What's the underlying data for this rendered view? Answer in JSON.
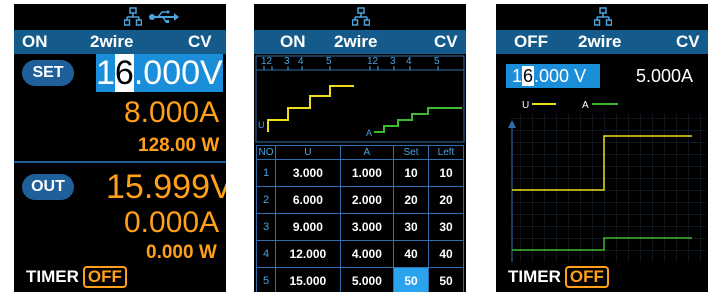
{
  "screen1": {
    "status": {
      "mode": "ON",
      "wire": "2wire",
      "cv": "CV"
    },
    "set": {
      "label": "SET",
      "volt_digit_cursor": "6",
      "volt_prefix": "1",
      "volt_rest": ".000V",
      "current": "8.000A",
      "power": "128.00 W"
    },
    "out": {
      "label": "OUT",
      "voltage": "15.999V",
      "current": "0.000A",
      "power": "0.000 W"
    },
    "timer": {
      "label": "TIMER",
      "state": "OFF"
    }
  },
  "screen2": {
    "status": {
      "mode": "ON",
      "wire": "2wire",
      "cv": "CV"
    },
    "ruler_left": [
      "12",
      "3",
      "4",
      "5"
    ],
    "ruler_right": [
      "12",
      "3",
      "4",
      "5"
    ],
    "graph_v_label": "U",
    "graph_a_label": "A",
    "table": {
      "headers": [
        "NO",
        "U",
        "A",
        "Set",
        "Left"
      ],
      "rows": [
        [
          "1",
          "3.000",
          "1.000",
          "10",
          "10"
        ],
        [
          "2",
          "6.000",
          "2.000",
          "20",
          "20"
        ],
        [
          "3",
          "9.000",
          "3.000",
          "30",
          "30"
        ],
        [
          "4",
          "12.000",
          "4.000",
          "40",
          "40"
        ],
        [
          "5",
          "15.000",
          "5.000",
          "50",
          "50"
        ]
      ]
    }
  },
  "screen3": {
    "status": {
      "mode": "OFF",
      "wire": "2wire",
      "cv": "CV"
    },
    "set_voltage_prefix": "1",
    "set_voltage_cursor": "6",
    "set_voltage_rest": ".000 V",
    "set_current": "5.000A",
    "legend_v": "U",
    "legend_a": "A",
    "timer": {
      "label": "TIMER",
      "state": "OFF"
    }
  },
  "colors": {
    "accent_blue": "#1f5f9a",
    "orange": "#ff9f1a",
    "yellow": "#f0dc1e",
    "green": "#3dbb2e"
  }
}
